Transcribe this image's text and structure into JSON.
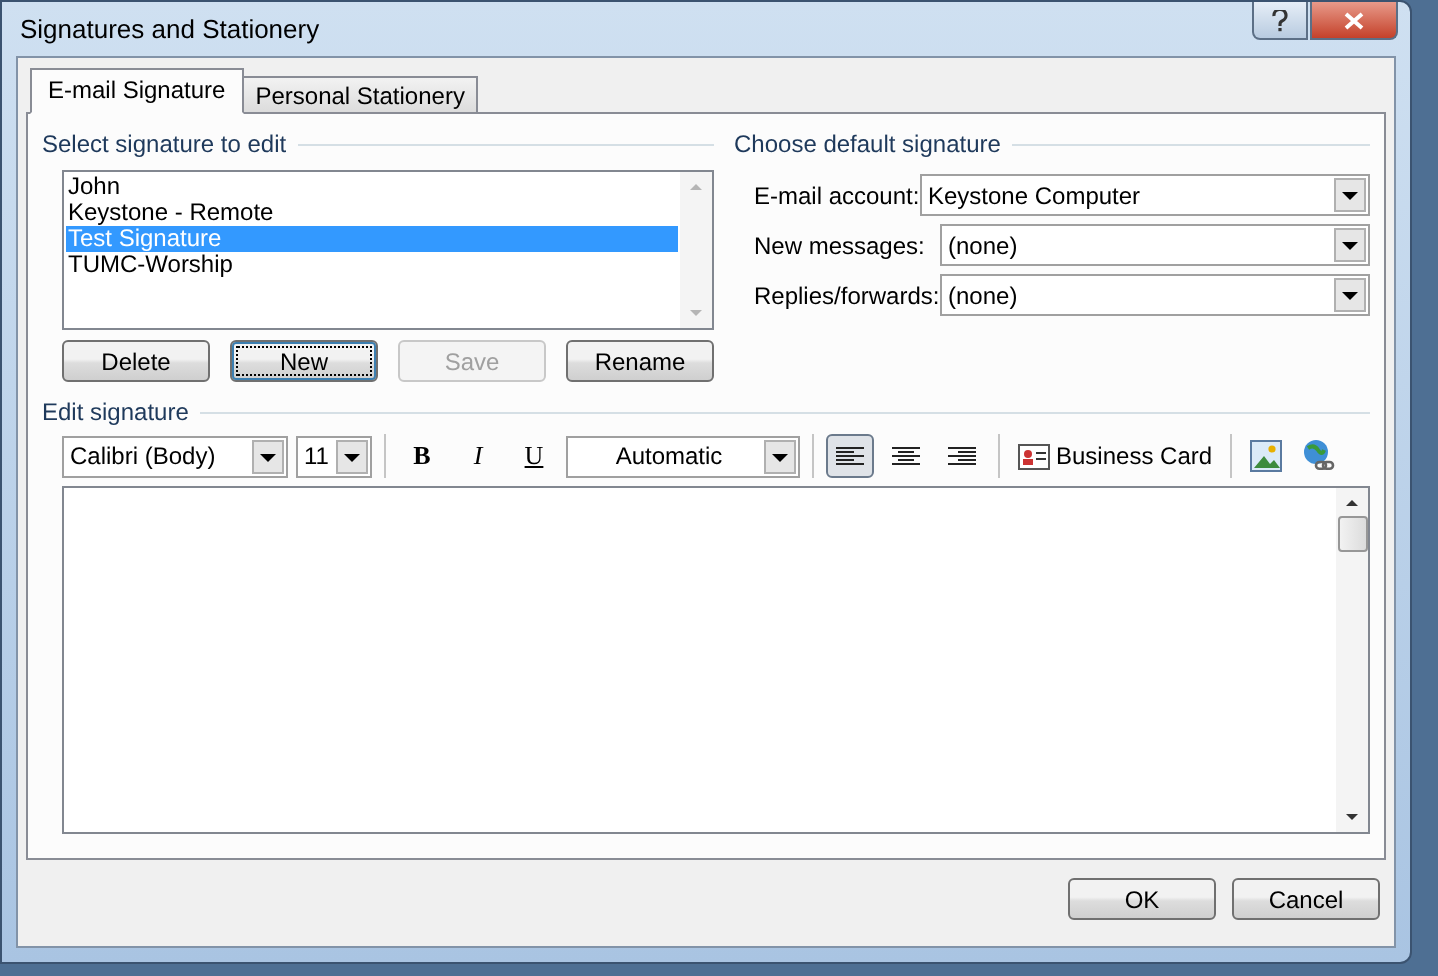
{
  "window": {
    "title": "Signatures and Stationery"
  },
  "tabs": [
    {
      "label": "E-mail Signature",
      "selected": true
    },
    {
      "label": "Personal Stationery",
      "selected": false
    }
  ],
  "select_signature": {
    "label": "Select signature to edit",
    "items": [
      {
        "label": "John",
        "selected": false
      },
      {
        "label": "Keystone - Remote",
        "selected": false
      },
      {
        "label": "Test Signature",
        "selected": true
      },
      {
        "label": "TUMC-Worship",
        "selected": false
      }
    ],
    "buttons": [
      {
        "label": "Delete",
        "disabled": false,
        "focused": false
      },
      {
        "label": "New",
        "disabled": false,
        "focused": true
      },
      {
        "label": "Save",
        "disabled": true,
        "focused": false
      },
      {
        "label": "Rename",
        "disabled": false,
        "focused": false
      }
    ]
  },
  "default_signature": {
    "label": "Choose default signature",
    "fields": [
      {
        "label": "E-mail account:",
        "value": "Keystone Computer"
      },
      {
        "label": "New messages:",
        "value": "(none)"
      },
      {
        "label": "Replies/forwards:",
        "value": "(none)"
      }
    ]
  },
  "edit_signature": {
    "label": "Edit signature",
    "toolbar": {
      "font": "Calibri (Body)",
      "size": "11",
      "bold": "B",
      "italic": "I",
      "underline": "U",
      "font_color_option": "Automatic",
      "alignment": [
        {
          "kind": "left",
          "selected": true
        },
        {
          "kind": "center",
          "selected": false
        },
        {
          "kind": "right",
          "selected": false
        }
      ],
      "business_card": "Business Card"
    }
  },
  "footer_buttons": [
    "OK",
    "Cancel"
  ]
}
